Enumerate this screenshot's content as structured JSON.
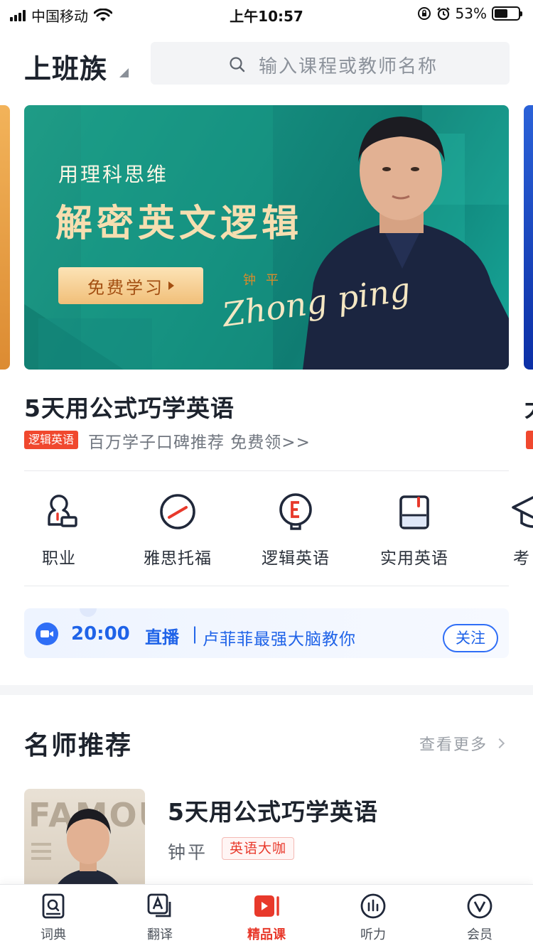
{
  "status_bar": {
    "carrier": "中国移动",
    "time": "上午10:57",
    "battery": "53%",
    "battery_level": 0.53
  },
  "header": {
    "city": "上班族",
    "search_placeholder": "输入课程或教师名称"
  },
  "banner": {
    "kicker": "用理科思维",
    "title": "解密英文逻辑",
    "cta_label": "免费学习",
    "teacher_cn": "钟平",
    "teacher_sign": "Zhong ping"
  },
  "featured": {
    "title": "5天用公式巧学英语",
    "tag": "逻辑英语",
    "desc": "百万学子口碑推荐 免费领>>",
    "peek_title": "大"
  },
  "categories": [
    {
      "label": "职业",
      "icon": "person-badge-icon"
    },
    {
      "label": "雅思托福",
      "icon": "gauge-icon"
    },
    {
      "label": "逻辑英语",
      "icon": "e-bulb-icon"
    },
    {
      "label": "实用英语",
      "icon": "book-icon"
    },
    {
      "label": "考",
      "icon": "grad-cap-icon"
    }
  ],
  "live": {
    "time": "20:00",
    "tag": "直播",
    "separator": "|",
    "text": "卢菲菲最强大脑教你",
    "follow_label": "关注"
  },
  "section": {
    "title": "名师推荐",
    "more_label": "查看更多"
  },
  "recommendation": {
    "cover_text": "FAMOUS",
    "title": "5天用公式巧学英语",
    "teacher": "钟平",
    "tag": "英语大咖"
  },
  "tabbar": [
    {
      "label": "词典",
      "icon": "dictionary-icon",
      "active": false
    },
    {
      "label": "翻译",
      "icon": "translate-icon",
      "active": false
    },
    {
      "label": "精品课",
      "icon": "video-course-icon",
      "active": true
    },
    {
      "label": "听力",
      "icon": "audio-bars-icon",
      "active": false
    },
    {
      "label": "会员",
      "icon": "vip-icon",
      "active": false
    }
  ],
  "colors": {
    "accent_red": "#e8392b",
    "live_blue": "#1f63e8",
    "banner_green": "#148a7c",
    "cta_gold": "#f1bf79"
  }
}
